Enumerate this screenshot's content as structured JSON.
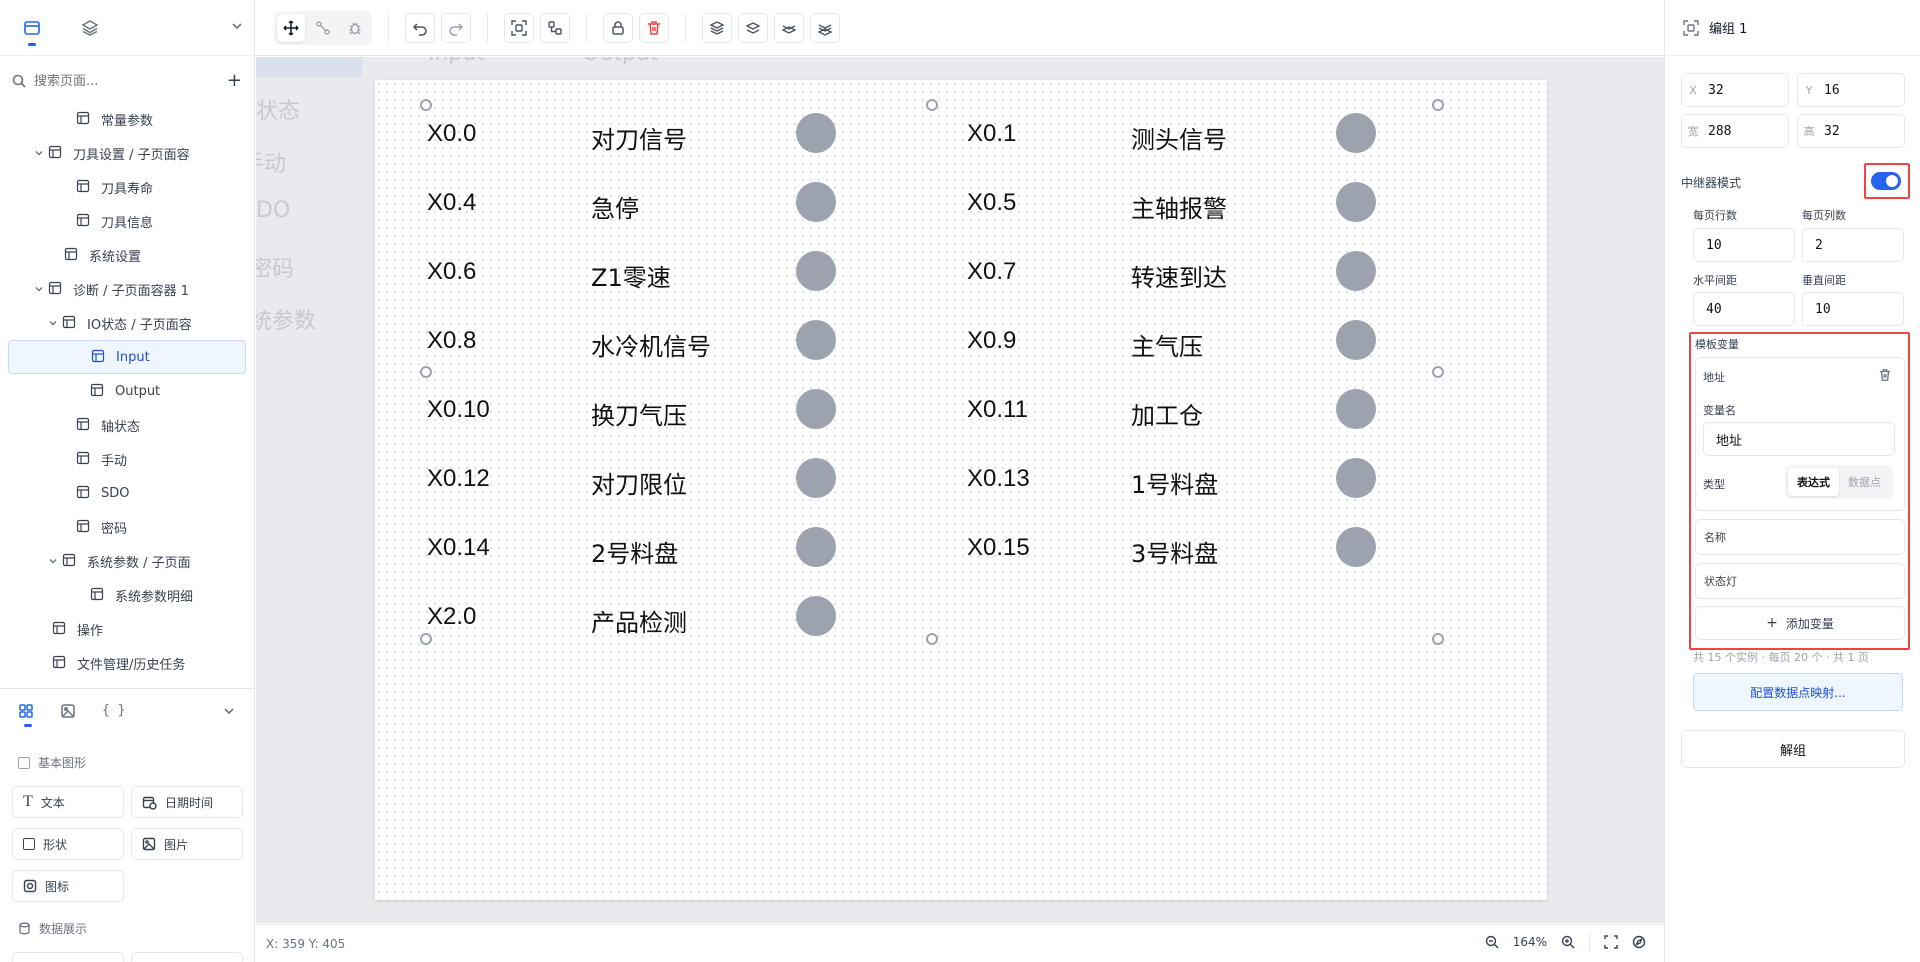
{
  "sidebar": {
    "search_placeholder": "搜索页面...",
    "tree": [
      {
        "label": "常量参数",
        "indent": 76,
        "caret": false
      },
      {
        "label": "刀具设置 / 子页面容",
        "indent": 48,
        "caret": true
      },
      {
        "label": "刀具寿命",
        "indent": 76,
        "caret": false
      },
      {
        "label": "刀具信息",
        "indent": 76,
        "caret": false
      },
      {
        "label": "系统设置",
        "indent": 64,
        "caret": false
      },
      {
        "label": "诊断 / 子页面容器 1",
        "indent": 48,
        "caret": true
      },
      {
        "label": "IO状态 / 子页面容",
        "indent": 62,
        "caret": true
      },
      {
        "label": "Input",
        "indent": 90,
        "caret": false,
        "selected": true
      },
      {
        "label": "Output",
        "indent": 90,
        "caret": false
      },
      {
        "label": "轴状态",
        "indent": 76,
        "caret": false
      },
      {
        "label": "手动",
        "indent": 76,
        "caret": false
      },
      {
        "label": "SDO",
        "indent": 76,
        "caret": false
      },
      {
        "label": "密码",
        "indent": 76,
        "caret": false
      },
      {
        "label": "系统参数 / 子页面",
        "indent": 62,
        "caret": true
      },
      {
        "label": "系统参数明细",
        "indent": 90,
        "caret": false
      },
      {
        "label": "操作",
        "indent": 52,
        "caret": false
      },
      {
        "label": "文件管理/历史任务",
        "indent": 52,
        "caret": false
      }
    ],
    "widgets": {
      "section_basic": "基本图形",
      "text": "文本",
      "datetime": "日期时间",
      "shape": "形状",
      "image": "图片",
      "icon": "图标",
      "section_data": "数据展示"
    }
  },
  "canvas": {
    "ghost_labels": [
      "Input",
      "Output",
      "状态",
      "手动",
      "DO",
      "密码",
      "统参数"
    ],
    "io_cells": [
      {
        "addr": "X0.0",
        "name": "对刀信号",
        "col": 0,
        "row": 0
      },
      {
        "addr": "X0.1",
        "name": "测头信号",
        "col": 1,
        "row": 0
      },
      {
        "addr": "X0.4",
        "name": "急停",
        "col": 0,
        "row": 1
      },
      {
        "addr": "X0.5",
        "name": "主轴报警",
        "col": 1,
        "row": 1
      },
      {
        "addr": "X0.6",
        "name": "Z1零速",
        "col": 0,
        "row": 2
      },
      {
        "addr": "X0.7",
        "name": "转速到达",
        "col": 1,
        "row": 2
      },
      {
        "addr": "X0.8",
        "name": "水冷机信号",
        "col": 0,
        "row": 3
      },
      {
        "addr": "X0.9",
        "name": "主气压",
        "col": 1,
        "row": 3
      },
      {
        "addr": "X0.10",
        "name": "换刀气压",
        "col": 0,
        "row": 4
      },
      {
        "addr": "X0.11",
        "name": "加工仓",
        "col": 1,
        "row": 4
      },
      {
        "addr": "X0.12",
        "name": "对刀限位",
        "col": 0,
        "row": 5
      },
      {
        "addr": "X0.13",
        "name": "1号料盘",
        "col": 1,
        "row": 5
      },
      {
        "addr": "X0.14",
        "name": "2号料盘",
        "col": 0,
        "row": 6
      },
      {
        "addr": "X0.15",
        "name": "3号料盘",
        "col": 1,
        "row": 6
      },
      {
        "addr": "X2.0",
        "name": "产品检测",
        "col": 0,
        "row": 7
      }
    ],
    "led_color": "#9ca3af"
  },
  "statusbar": {
    "coords": "X: 359 Y: 405",
    "zoom": "164%"
  },
  "inspector": {
    "title": "编组 1",
    "x_label": "X",
    "x": "32",
    "y_label": "Y",
    "y": "16",
    "w_label": "宽",
    "w": "288",
    "h_label": "高",
    "h": "32",
    "repeater_label": "中继器模式",
    "repeater_on": true,
    "rows_per_page_label": "每页行数",
    "rows_per_page": "10",
    "cols_per_page_label": "每页列数",
    "cols_per_page": "2",
    "h_gap_label": "水平间距",
    "h_gap": "40",
    "v_gap_label": "垂直间距",
    "v_gap": "10",
    "template_vars_label": "模板变量",
    "var_card_title": "地址",
    "var_name_label": "变量名",
    "var_name_value": "地址",
    "type_label": "类型",
    "type_options": [
      "表达式",
      "数据点"
    ],
    "var2": "名称",
    "var3": "状态灯",
    "add_var": "添加变量",
    "summary": "共 15 个实例 · 每页 20 个 · 共 1 页",
    "map_button": "配置数据点映射...",
    "ungroup_button": "解组",
    "accent": "#2563eb",
    "highlight": "#ef4444"
  }
}
